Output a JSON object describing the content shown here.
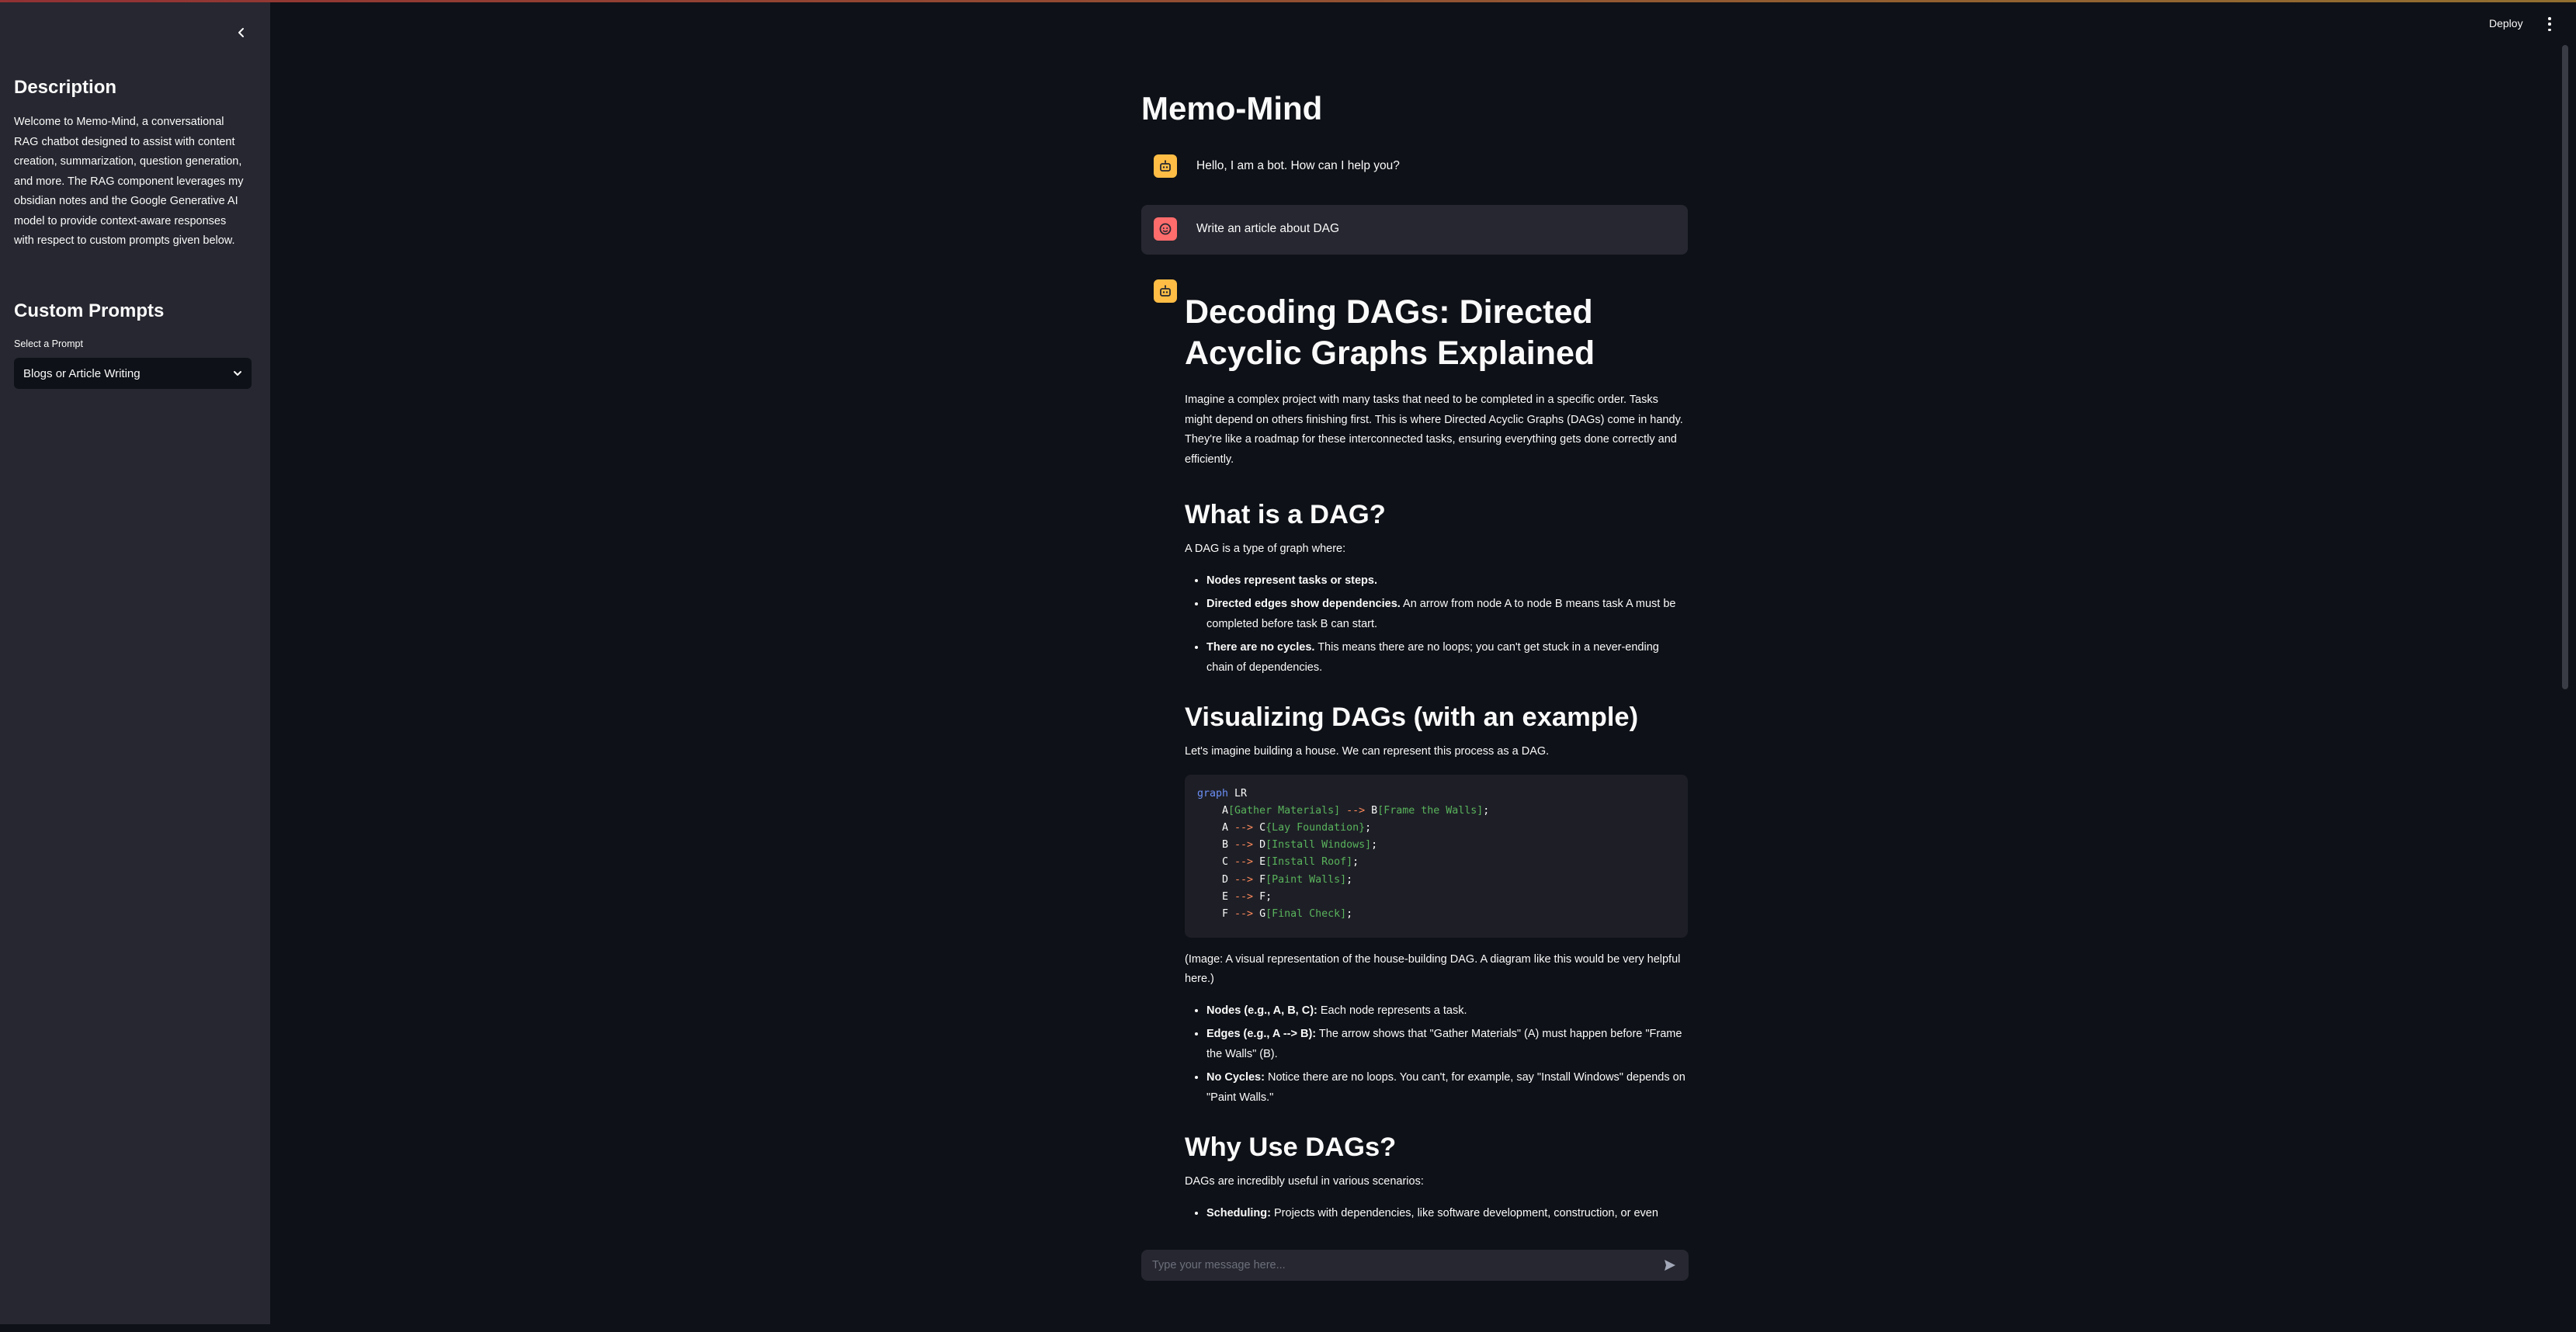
{
  "header": {
    "deploy_label": "Deploy",
    "menu_icon": "kebab-menu-icon"
  },
  "sidebar": {
    "collapse_icon": "chevron-left-icon",
    "description_title": "Description",
    "description_text": "Welcome to Memo-Mind, a conversational RAG chatbot designed to assist with content creation, summarization, question generation, and more. The RAG component leverages my obsidian notes and the Google Generative AI model to provide context-aware responses with respect to custom prompts given below.",
    "prompts_title": "Custom Prompts",
    "select_label": "Select a Prompt",
    "select_value": "Blogs or Article Writing"
  },
  "main": {
    "title": "Memo-Mind",
    "messages": [
      {
        "role": "assistant",
        "text": "Hello, I am a bot. How can I help you?"
      },
      {
        "role": "user",
        "text": "Write an article about DAG"
      }
    ],
    "article": {
      "h1": "Decoding DAGs: Directed Acyclic Graphs Explained",
      "intro": "Imagine a complex project with many tasks that need to be completed in a specific order. Tasks might depend on others finishing first. This is where Directed Acyclic Graphs (DAGs) come in handy. They're like a roadmap for these interconnected tasks, ensuring everything gets done correctly and efficiently.",
      "h_what": "What is a DAG?",
      "what_intro": "A DAG is a type of graph where:",
      "what_items": [
        {
          "bold": "Nodes represent tasks or steps.",
          "text": ""
        },
        {
          "bold": "Directed edges show dependencies.",
          "text": " An arrow from node A to node B means task A must be completed before task B can start."
        },
        {
          "bold": "There are no cycles.",
          "text": " This means there are no loops; you can't get stuck in a never-ending chain of dependencies."
        }
      ],
      "h_visual": "Visualizing DAGs (with an example)",
      "visual_intro": "Let's imagine building a house. We can represent this process as a DAG.",
      "code_lines": [
        [
          "graph",
          " LR"
        ],
        [
          "    A",
          "[Gather Materials]",
          " --> ",
          "B",
          "[Frame the Walls]",
          ";"
        ],
        [
          "    A",
          "",
          " --> ",
          "C",
          "{Lay Foundation}",
          ";"
        ],
        [
          "    B",
          "",
          " --> ",
          "D",
          "[Install Windows]",
          ";"
        ],
        [
          "    C",
          "",
          " --> ",
          "E",
          "[Install Roof]",
          ";"
        ],
        [
          "    D",
          "",
          " --> ",
          "F",
          "[Paint Walls]",
          ";"
        ],
        [
          "    E",
          "",
          " --> ",
          "F",
          "",
          ";"
        ],
        [
          "    F",
          "",
          " --> ",
          "G",
          "[Final Check]",
          ";"
        ]
      ],
      "image_note": "(Image: A visual representation of the house-building DAG. A diagram like this would be very helpful here.)",
      "explain_items": [
        {
          "bold": "Nodes (e.g., A, B, C):",
          "text": " Each node represents a task."
        },
        {
          "bold": "Edges (e.g., A --> B):",
          "text": " The arrow shows that \"Gather Materials\" (A) must happen before \"Frame the Walls\" (B)."
        },
        {
          "bold": "No Cycles:",
          "text": " Notice there are no loops. You can't, for example, say \"Install Windows\" depends on \"Paint Walls.\""
        }
      ],
      "h_why": "Why Use DAGs?",
      "why_intro": "DAGs are incredibly useful in various scenarios:",
      "why_items": [
        {
          "bold": "Scheduling:",
          "text": " Projects with dependencies, like software development, construction, or even"
        }
      ]
    }
  },
  "chat_input": {
    "placeholder": "Type your message here..."
  },
  "colors": {
    "background": "#0e1117",
    "sidebar": "#262730",
    "bot_avatar": "#ffbd45",
    "user_avatar": "#ff6c6c",
    "code_keyword": "#6c8ff6",
    "code_string": "#59b35c",
    "code_arrow": "#ff8a5c"
  }
}
